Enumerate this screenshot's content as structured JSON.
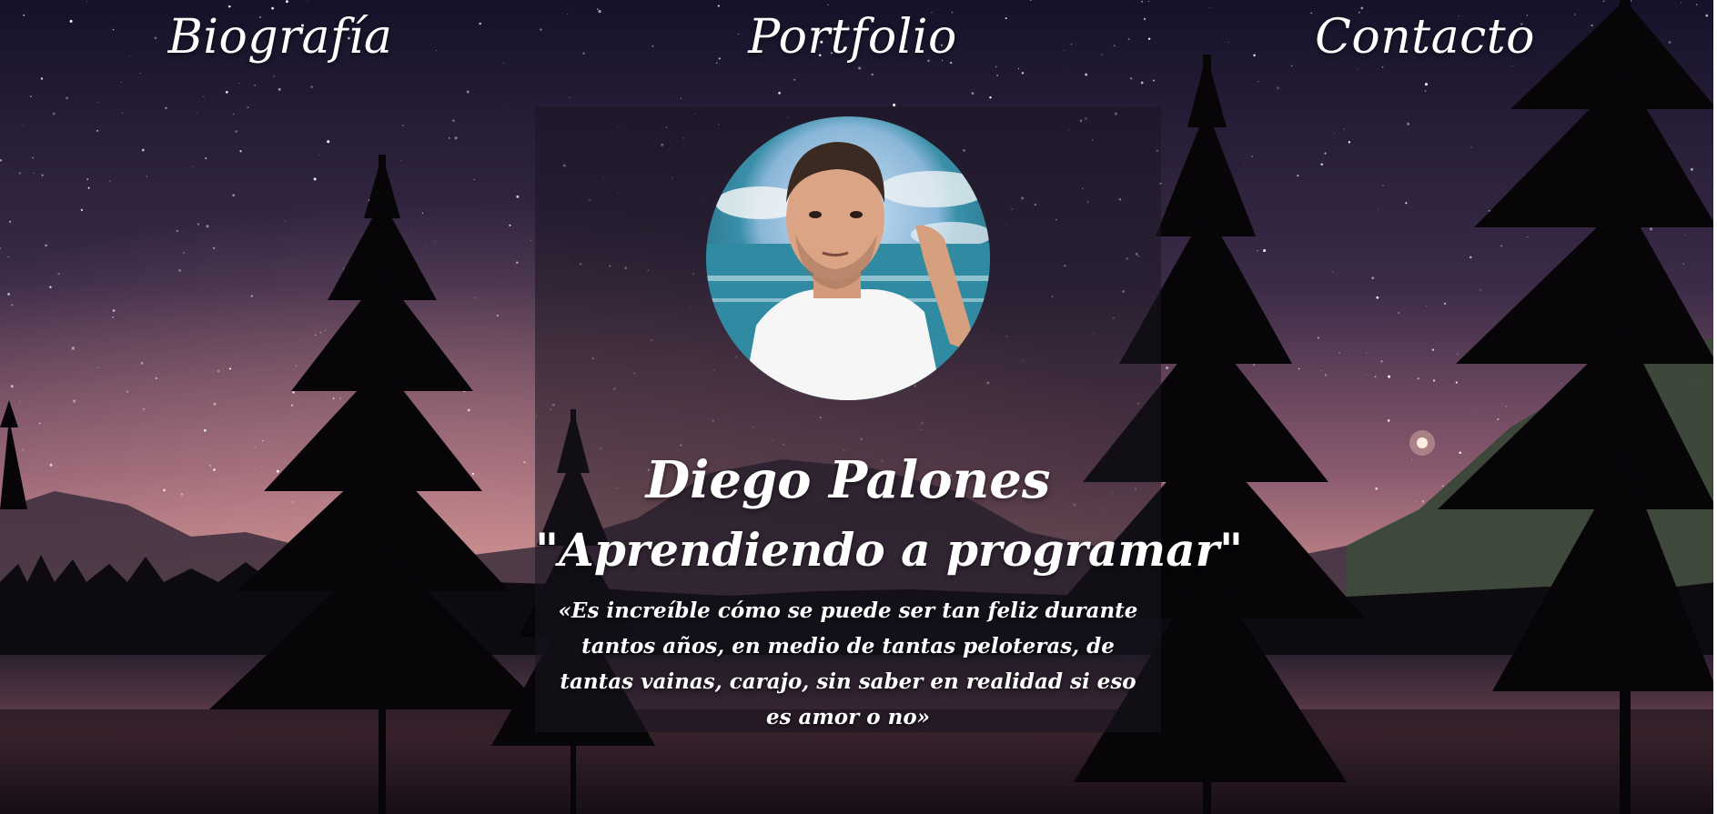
{
  "nav": {
    "biografia": "Biografía",
    "portfolio": "Portfolio",
    "contacto": "Contacto"
  },
  "profile": {
    "name": "Diego Palones",
    "motto": "\"Aprendiendo a programar\"",
    "quote": "«Es increíble cómo se puede ser tan feliz durante tantos años, en medio de tantas peloteras, de tantas vainas, carajo, sin saber en realidad si eso es amor o no»"
  },
  "colors": {
    "text": "#ffffff",
    "sky_top": "#1a1530",
    "sky_glow": "#c27d86",
    "card_overlay": "rgba(28,22,34,0.55)"
  },
  "icons": {
    "avatar": "profile-photo"
  }
}
